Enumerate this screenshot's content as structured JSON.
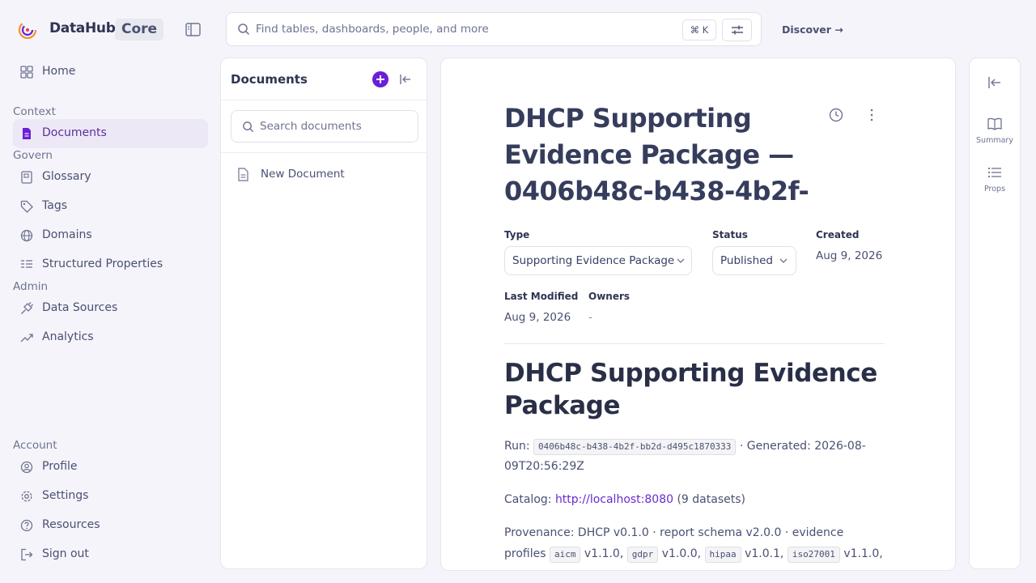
{
  "header": {
    "brand": "DataHub",
    "brand_tag": "Core",
    "search_placeholder": "Find tables, dashboards, people, and more",
    "search_shortcut": "⌘ K",
    "discover_label": "Discover →"
  },
  "nav": {
    "home": "Home",
    "context_section": "Context",
    "documents": "Documents",
    "govern_section": "Govern",
    "glossary": "Glossary",
    "tags": "Tags",
    "domains": "Domains",
    "structured_properties": "Structured Properties",
    "admin_section": "Admin",
    "data_sources": "Data Sources",
    "analytics": "Analytics",
    "account_section": "Account",
    "profile": "Profile",
    "settings": "Settings",
    "resources": "Resources",
    "sign_out": "Sign out"
  },
  "documents_panel": {
    "title": "Documents",
    "search_placeholder": "Search documents",
    "items": [
      "New Document"
    ]
  },
  "document": {
    "title": "DHCP Supporting Evidence Package — 0406b48c-b438-4b2f-",
    "type_label": "Type",
    "type_value": "Supporting Evidence Package",
    "status_label": "Status",
    "status_value": "Published",
    "created_label": "Created",
    "created_value": "Aug 9, 2026",
    "modified_label": "Last Modified",
    "modified_value": "Aug 9, 2026",
    "owners_label": "Owners",
    "owners_value": "-",
    "heading": "DHCP Supporting Evidence Package",
    "run_label": "Run:",
    "run_id": "0406b48c-b438-4b2f-bb2d-d495c1870333",
    "generated_text": "· Generated: 2026-08-09T20:56:29Z",
    "catalog_label": "Catalog:",
    "catalog_link": "http://localhost:8080",
    "catalog_suffix": "(9 datasets)",
    "provenance_text": "Provenance: DHCP v0.1.0 · report schema v2.0.0 · evidence profiles",
    "profiles": [
      {
        "name": "aicm",
        "version": "v1.1.0,"
      },
      {
        "name": "gdpr",
        "version": "v1.0.0,"
      },
      {
        "name": "hipaa",
        "version": "v1.0.1,"
      },
      {
        "name": "iso27001",
        "version": "v1.1.0,"
      }
    ]
  },
  "rail": {
    "summary": "Summary",
    "props": "Props"
  },
  "colors": {
    "accent": "#6b1fd6",
    "active_nav_bg": "#ede8f6",
    "link": "#6a2bd0"
  }
}
